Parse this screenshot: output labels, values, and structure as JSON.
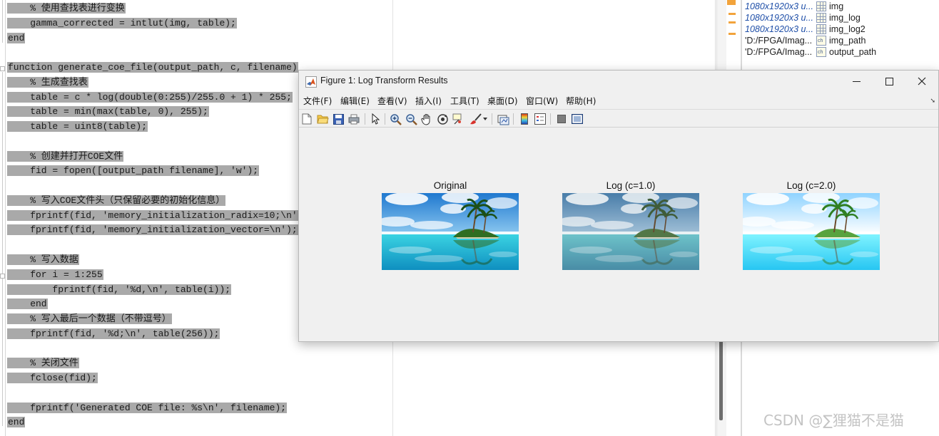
{
  "editor": {
    "lines": [
      "    % 使用查找表进行变换",
      "    gamma_corrected = intlut(img, table);",
      "end",
      "",
      "function generate_coe_file(output_path, c, filename)",
      "    % 生成查找表",
      "    table = c * log(double(0:255)/255.0 + 1) * 255;",
      "    table = min(max(table, 0), 255);",
      "    table = uint8(table);",
      "",
      "    % 创建并打开COE文件",
      "    fid = fopen([output_path filename], 'w');",
      "",
      "    % 写入COE文件头（只保留必要的初始化信息）",
      "    fprintf(fid, 'memory_initialization_radix=10;\\n');",
      "    fprintf(fid, 'memory_initialization_vector=\\n');",
      "",
      "    % 写入数据",
      "    for i = 1:255",
      "        fprintf(fid, '%d,\\n', table(i));",
      "    end",
      "    % 写入最后一个数据（不带逗号）",
      "    fprintf(fid, '%d;\\n', table(256));",
      "",
      "    % 关闭文件",
      "    fclose(fid);",
      "",
      "    fprintf('Generated COE file: %s\\n', filename);",
      "end"
    ]
  },
  "workspace": {
    "rows": [
      {
        "value": "1080x1920x3 u...",
        "name": "img",
        "type": "array"
      },
      {
        "value": "1080x1920x3 u...",
        "name": "img_log",
        "type": "array"
      },
      {
        "value": "1080x1920x3 u...",
        "name": "img_log2",
        "type": "array"
      },
      {
        "value": "'D:/FPGA/Imag...",
        "name": "img_path",
        "type": "char"
      },
      {
        "value": "'D:/FPGA/Imag...",
        "name": "output_path",
        "type": "char"
      }
    ]
  },
  "figure": {
    "title": "Figure 1: Log Transform Results",
    "menus": [
      "文件(F)",
      "编辑(E)",
      "查看(V)",
      "插入(I)",
      "工具(T)",
      "桌面(D)",
      "窗口(W)",
      "帮助(H)"
    ],
    "toolbar_icons": [
      "new-file-icon",
      "open-file-icon",
      "save-icon",
      "print-icon",
      "select-arrow-icon",
      "zoom-in-icon",
      "zoom-out-icon",
      "pan-hand-icon",
      "rotate-3d-icon",
      "data-cursor-icon",
      "brush-icon",
      "link-plot-icon",
      "colorbar-icon",
      "legend-icon",
      "hide-plot-tools-icon",
      "show-plot-tools-icon"
    ],
    "axes": [
      {
        "title": "Original",
        "variant": "original"
      },
      {
        "title": "Log (c=1.0)",
        "variant": "log1"
      },
      {
        "title": "Log (c=2.0)",
        "variant": "log2"
      }
    ]
  },
  "watermark": "CSDN @∑狸猫不是猫",
  "colors": {
    "selection": "#a9a9a9",
    "workspace_value": "#1f4fa8",
    "sky_blue": "#2f8fd8",
    "sea_turquoise": "#31c7d8"
  }
}
